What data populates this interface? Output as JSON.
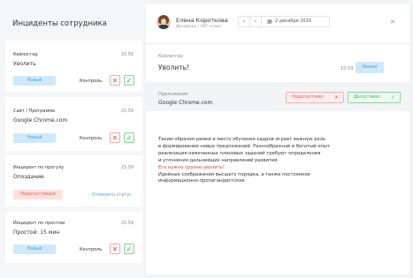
{
  "left": {
    "title": "Инциденты сотрудника",
    "cards": [
      {
        "type": "Кейлоггер",
        "time": "15:59",
        "subject": "Уволить",
        "status": "Новый",
        "control": "Контроль"
      },
      {
        "type": "Сайт / Программа",
        "time": "15:59",
        "subject": "Google Chrome.com",
        "status": "Новый",
        "control": "Контроль"
      },
      {
        "type": "Инцидент по прогулу",
        "time": "15:59",
        "subject": "Опоздание",
        "status": "Недопустимый",
        "cancel": "Отменить статус"
      },
      {
        "type": "Инцидент по простою",
        "time": "15:59",
        "subject": "Простой: 15 мин",
        "status": "Новый",
        "control": "Контроль"
      }
    ]
  },
  "detail": {
    "user_name": "Елена Короткова",
    "user_role": "Дизайнер / ART отдел",
    "date": "2 декабря 2020",
    "keylogger_label": "Кейлоггер",
    "keylogger_title": "Уволить!",
    "time": "15:59",
    "status": "Новый",
    "app_label": "Приложение",
    "app_value": "Google Chrome.com",
    "unacceptable": "Недопустимо",
    "acceptable": "Допустимо",
    "text_lines": [
      "Таким образом рамки и место обучения кадров играет важную роль",
      "в формировании новых предложений. Разнообразный и богатый опыт",
      "реализация намеченных плановых заданий требуют определения",
      "и уточнения дальнейших направлений развития."
    ],
    "text_red": "Его нужно срочно уволить!",
    "text_tail": [
      "Идейные соображения высшего порядка, а также постоянное",
      "информационно-пропагандистское"
    ]
  },
  "icons": {
    "close": "close-icon",
    "accept": "check-icon",
    "reject": "cross-icon",
    "calendar": "calendar-icon",
    "prev": "chevron-left-icon",
    "next": "chevron-right-icon"
  },
  "colors": {
    "new_status": "#cfe9fb",
    "new_text": "#4aa3df",
    "bad": "#e15a5a",
    "good": "#3bb55a"
  }
}
